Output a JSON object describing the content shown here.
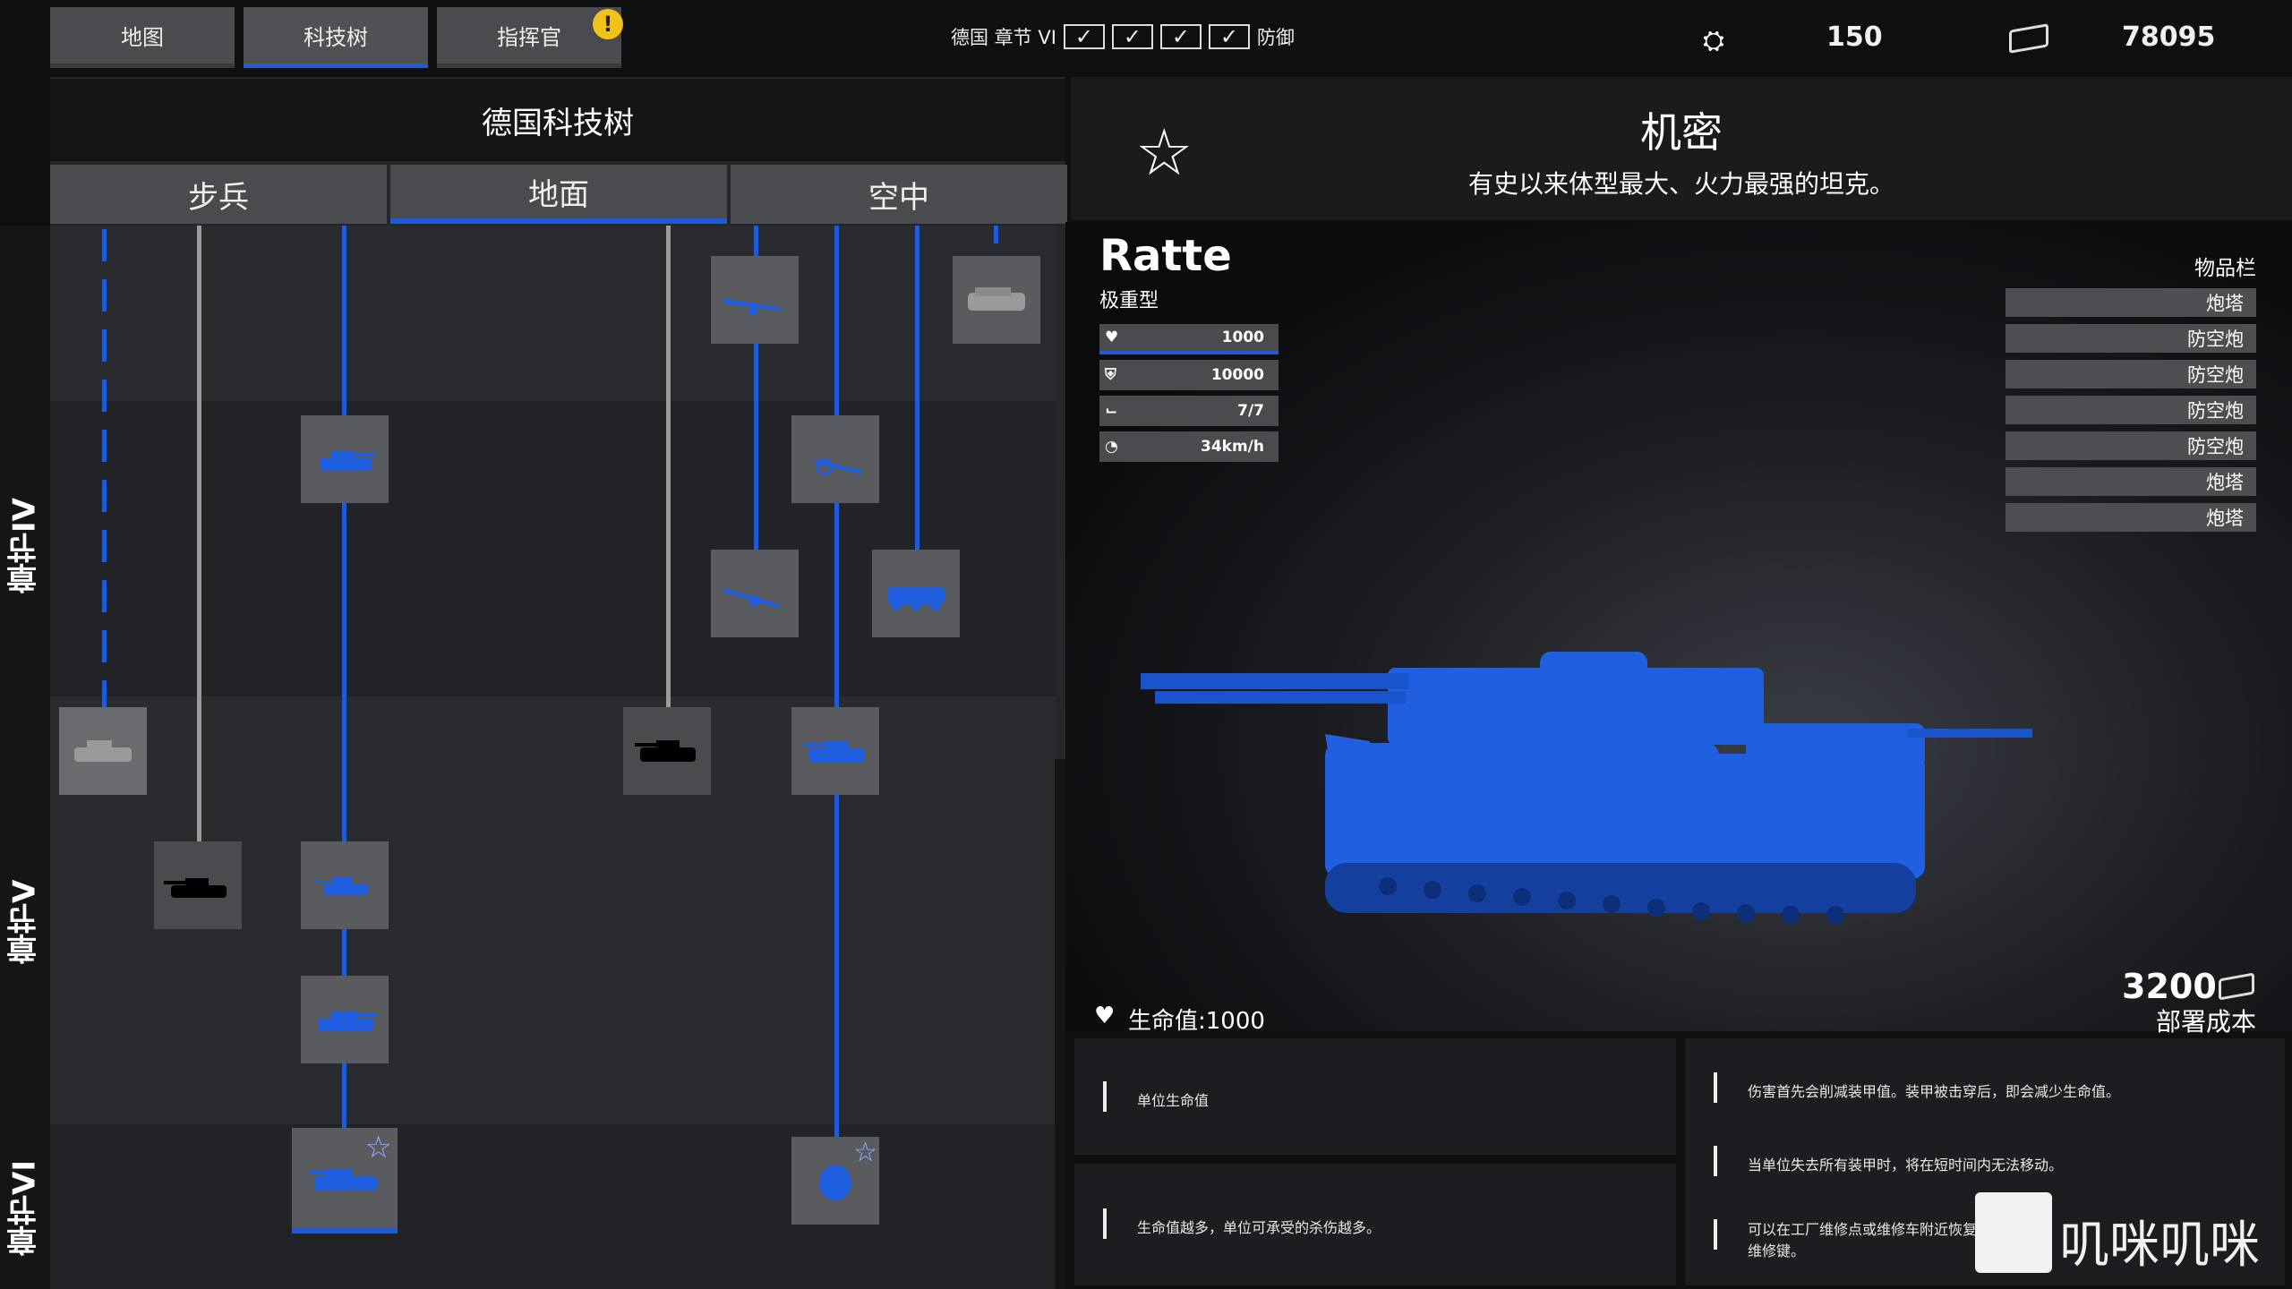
{
  "top_tabs": [
    {
      "label": "地图"
    },
    {
      "label": "科技树"
    },
    {
      "label": "指挥官"
    }
  ],
  "warning_badge": "!",
  "chapter_status": {
    "prefix": "德国 章节 VI",
    "mode": "防御"
  },
  "resources": {
    "units_value": "150",
    "money_value": "78095"
  },
  "tech_tree": {
    "title": "德国科技树",
    "tabs": [
      "步兵",
      "地面",
      "空中"
    ],
    "chapters": [
      "章节IV",
      "章节V",
      "章节VI"
    ]
  },
  "detail": {
    "classified_title": "机密",
    "description": "有史以来体型最大、火力最强的坦克。",
    "unit_name": "Ratte",
    "unit_class": "极重型",
    "stats": [
      "1000",
      "10000",
      "7/7",
      "34km/h"
    ],
    "inventory_title": "物品栏",
    "inventory": [
      "炮塔",
      "防空炮",
      "防空炮",
      "防空炮",
      "防空炮",
      "炮塔",
      "炮塔"
    ],
    "hp_label": "生命值:1000",
    "deploy_cost": "3200",
    "deploy_label": "部署成本",
    "info_left": [
      "单位生命值",
      "生命值越多，单位可承受的杀伤越多。"
    ],
    "info_right": [
      "伤害首先会削减装甲值。装甲被击穿后，即会减少生命值。",
      "当单位失去所有装甲时，将在短时间内无法移动。",
      "可以在工厂维修点或维修车附近恢复装甲，按下维修键。"
    ]
  },
  "watermark": "叽咪叽咪",
  "colors": {
    "accent": "#1e5bd6",
    "unit_blue": "#1f5fe0",
    "panel": "#4a4b4e"
  }
}
